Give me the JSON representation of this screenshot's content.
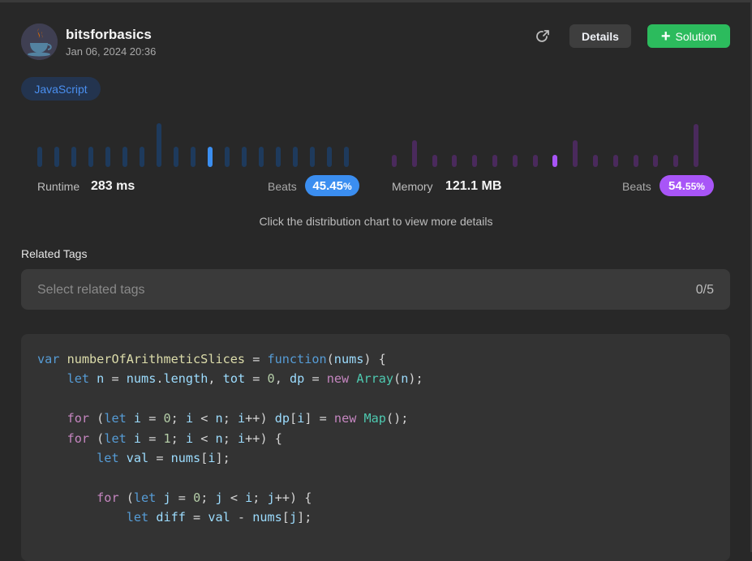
{
  "header": {
    "username": "bitsforbasics",
    "timestamp": "Jan 06, 2024 20:36",
    "details_label": "Details",
    "solution_label": "Solution"
  },
  "language": "JavaScript",
  "runtime": {
    "label": "Runtime",
    "value": "283 ms",
    "beats_label": "Beats",
    "beats_main": "45.45",
    "beats_suffix": "%",
    "bar_levels": [
      0.47,
      0.47,
      0.47,
      0.47,
      0.47,
      0.47,
      0.47,
      1.0,
      0.47,
      0.47,
      0.47,
      0.47,
      0.47,
      0.47,
      0.47,
      0.47,
      0.47,
      0.47,
      0.47
    ],
    "highlight_index": 10,
    "color": "#3b8ef0",
    "dim_color": "#1e3a5c"
  },
  "memory": {
    "label": "Memory",
    "value": "121.1 MB",
    "beats_label": "Beats",
    "beats_main": "54.",
    "beats_suffix": "55%",
    "bar_levels": [
      0.27,
      0.62,
      0.27,
      0.27,
      0.27,
      0.27,
      0.27,
      0.27,
      0.27,
      0.62,
      0.27,
      0.27,
      0.27,
      0.27,
      0.27,
      0.98
    ],
    "highlight_index": 8,
    "color": "#a855f7",
    "dim_color": "#4a2a5c"
  },
  "hint": "Click the distribution chart to view more details",
  "tags": {
    "title": "Related Tags",
    "placeholder": "Select related tags",
    "count": "0/5"
  },
  "code": [
    "var numberOfArithmeticSlices = function(nums) {",
    "    let n = nums.length, tot = 0, dp = new Array(n);",
    "",
    "    for (let i = 0; i < n; i++) dp[i] = new Map();",
    "    for (let i = 1; i < n; i++) {",
    "        let val = nums[i];",
    "",
    "        for (let j = 0; j < i; j++) {",
    "            let diff = val - nums[j];"
  ]
}
